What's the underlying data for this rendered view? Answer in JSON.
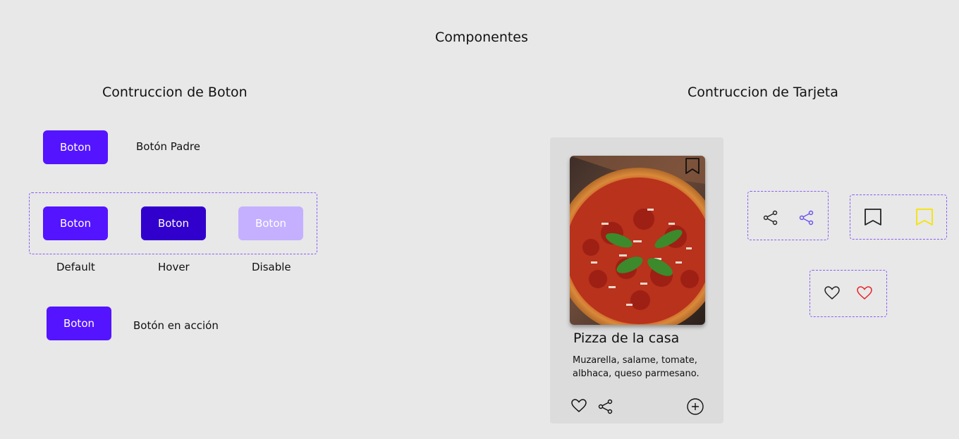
{
  "page": {
    "title": "Componentes"
  },
  "buttons_section": {
    "title": "Contruccion de Boton",
    "parent": {
      "button_label": "Boton",
      "caption": "Botón Padre"
    },
    "states": [
      {
        "button_label": "Boton",
        "caption": "Default",
        "color": "#5414ff"
      },
      {
        "button_label": "Boton",
        "caption": "Hover",
        "color": "#3200cc"
      },
      {
        "button_label": "Boton",
        "caption": "Disable",
        "color": "#c4b0ff"
      }
    ],
    "action": {
      "button_label": "Boton",
      "caption": "Botón en acción"
    },
    "primary_color": "#5414ff"
  },
  "card_section": {
    "title": "Contruccion de Tarjeta",
    "card": {
      "title": "Pizza de la casa",
      "description": "Muzarella, salame, tomate, albhaca, queso parmesano.",
      "icons": [
        "bookmark-icon",
        "heart-icon",
        "share-icon",
        "plus-circle-icon"
      ]
    },
    "icon_variants": {
      "share": {
        "default_color": "#222222",
        "active_color": "#6b4ef0"
      },
      "bookmark": {
        "default_color": "#222222",
        "active_color": "#f5e400"
      },
      "heart": {
        "default_color": "#222222",
        "active_color": "#e8232a"
      }
    }
  }
}
